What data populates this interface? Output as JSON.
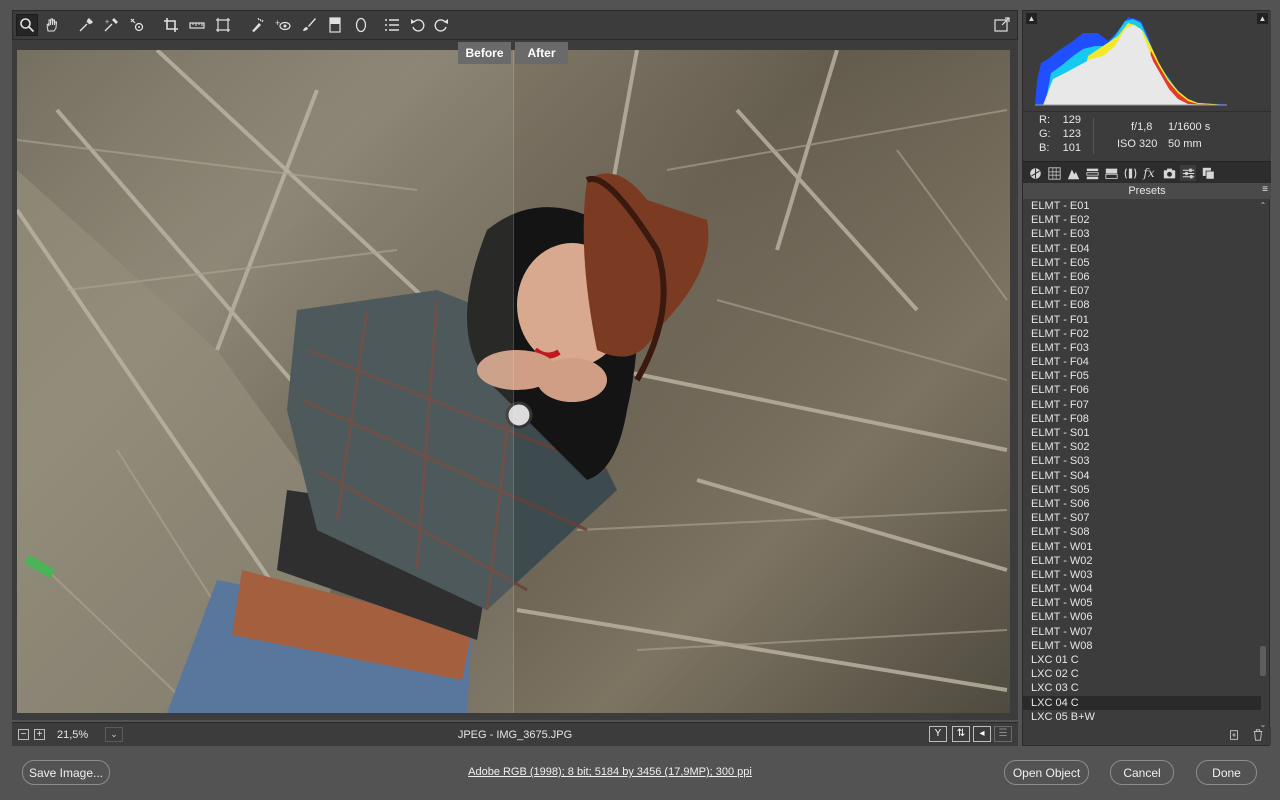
{
  "toolbar": {
    "tools": [
      {
        "name": "zoom-tool-icon",
        "glyph": "⌕",
        "active": true
      },
      {
        "name": "hand-tool-icon",
        "glyph": "✋"
      },
      {
        "name": "white-balance-tool-icon",
        "glyph": "✎"
      },
      {
        "name": "color-sampler-tool-icon",
        "glyph": "✐"
      },
      {
        "name": "targeted-adjustment-tool-icon",
        "glyph": "◎"
      },
      {
        "name": "crop-tool-icon",
        "glyph": "⌗"
      },
      {
        "name": "straighten-tool-icon",
        "glyph": "▭"
      },
      {
        "name": "transform-tool-icon",
        "glyph": "⊡"
      },
      {
        "name": "spot-removal-tool-icon",
        "glyph": "✏"
      },
      {
        "name": "red-eye-removal-icon",
        "glyph": "+◉"
      },
      {
        "name": "adjustment-brush-icon",
        "glyph": "🖌"
      },
      {
        "name": "graduated-filter-icon",
        "glyph": "▤"
      },
      {
        "name": "radial-filter-icon",
        "glyph": "◯"
      },
      {
        "name": "preferences-icon",
        "glyph": "☰"
      },
      {
        "name": "rotate-left-icon",
        "glyph": "↺"
      },
      {
        "name": "rotate-right-icon",
        "glyph": "↻"
      }
    ],
    "fullscreen_icon": "⇱"
  },
  "compare": {
    "before_label": "Before",
    "after_label": "After"
  },
  "status": {
    "zoom_minus": "−",
    "zoom_plus": "+",
    "zoom_level": "21,5%",
    "zoom_dropdown": "⌄",
    "file_info": "JPEG  -  IMG_3675.JPG"
  },
  "histogram": {
    "colors": {
      "red": "#e23a2c",
      "yellow": "#f3e829",
      "blue": "#1f4fff",
      "cyan": "#18c9ef",
      "white": "#e8e8e8"
    }
  },
  "readout": {
    "r_label": "R:",
    "r_value": "129",
    "g_label": "G:",
    "g_value": "123",
    "b_label": "B:",
    "b_value": "101",
    "aperture": "f/1,8",
    "shutter": "1/1600 s",
    "iso": "ISO 320",
    "focal": "50 mm"
  },
  "panel": {
    "title": "Presets",
    "presets": [
      "ELMT - E01",
      "ELMT - E02",
      "ELMT - E03",
      "ELMT - E04",
      "ELMT - E05",
      "ELMT - E06",
      "ELMT - E07",
      "ELMT - E08",
      "ELMT - F01",
      "ELMT - F02",
      "ELMT - F03",
      "ELMT - F04",
      "ELMT - F05",
      "ELMT - F06",
      "ELMT - F07",
      "ELMT - F08",
      "ELMT - S01",
      "ELMT - S02",
      "ELMT - S03",
      "ELMT - S04",
      "ELMT - S05",
      "ELMT - S06",
      "ELMT - S07",
      "ELMT - S08",
      "ELMT - W01",
      "ELMT - W02",
      "ELMT - W03",
      "ELMT - W04",
      "ELMT - W05",
      "ELMT - W06",
      "ELMT - W07",
      "ELMT - W08",
      "LXC 01 C",
      "LXC 02 C",
      "LXC 03 C",
      "LXC 04 C",
      "LXC 05 B+W"
    ],
    "selected": "LXC 04 C"
  },
  "footer": {
    "save_label": "Save Image...",
    "workflow_text": "Adobe RGB (1998); 8 bit; 5184 by 3456 (17,9MP); 300 ppi",
    "open_label": "Open Object",
    "cancel_label": "Cancel",
    "done_label": "Done"
  }
}
